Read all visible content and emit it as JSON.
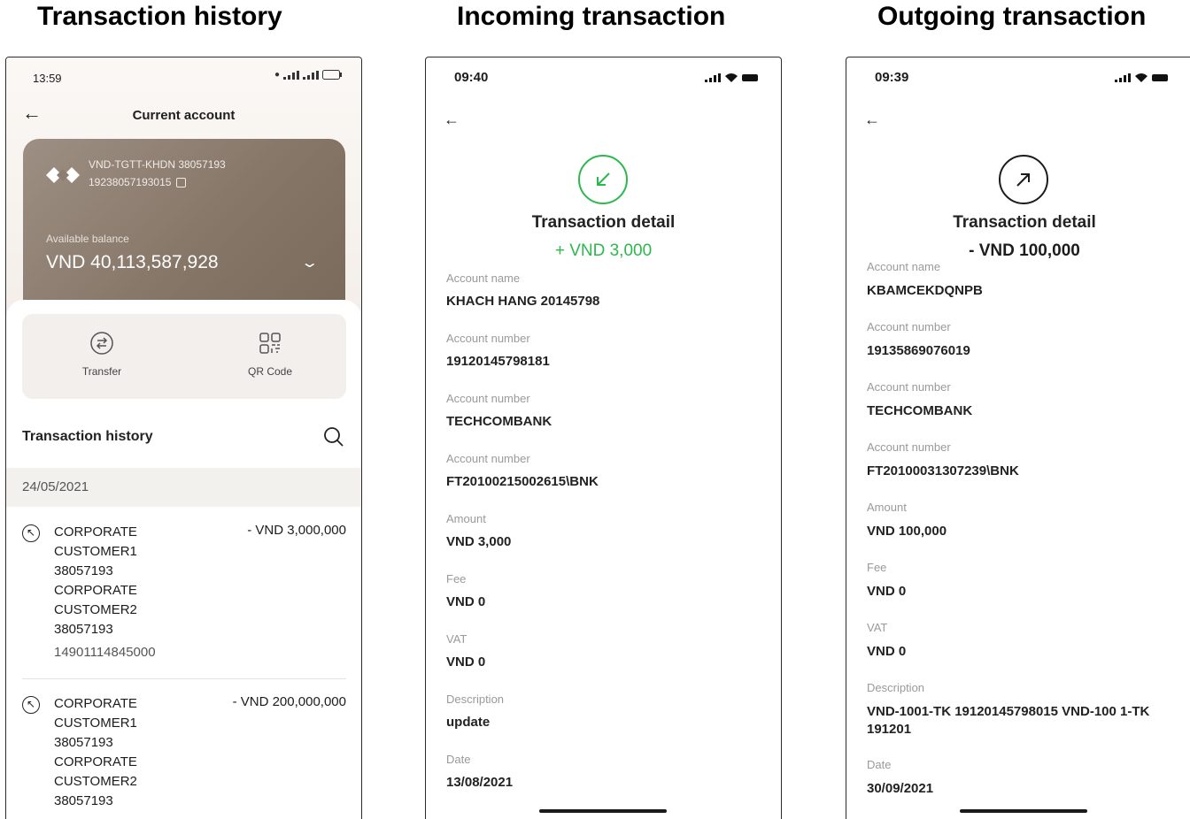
{
  "headings": {
    "history": "Transaction history",
    "incoming": "Incoming transaction",
    "outgoing": "Outgoing transaction"
  },
  "phone1": {
    "time": "13:59",
    "header_title": "Current account",
    "card": {
      "account_name": "VND-TGTT-KHDN 38057193",
      "account_number": "19238057193015",
      "balance_label": "Available balance",
      "balance": "VND 40,113,587,928"
    },
    "actions": [
      {
        "label": "Transfer",
        "icon": "transfer-icon"
      },
      {
        "label": "QR Code",
        "icon": "qr-code-icon"
      }
    ],
    "history_title": "Transaction history",
    "date": "24/05/2021",
    "transactions": [
      {
        "lines": [
          "CORPORATE",
          "CUSTOMER1",
          "38057193",
          "CORPORATE",
          "CUSTOMER2",
          "38057193"
        ],
        "ref": "14901114845000",
        "amount": "- VND 3,000,000"
      },
      {
        "lines": [
          "CORPORATE",
          "CUSTOMER1",
          "38057193",
          "CORPORATE",
          "CUSTOMER2",
          "38057193"
        ],
        "ref": "",
        "amount": "- VND 200,000,000"
      }
    ]
  },
  "phone2": {
    "time": "09:40",
    "title": "Transaction detail",
    "amount": "+ VND 3,000",
    "amount_color": "#2db84d",
    "fields": [
      {
        "label": "Account name",
        "value": "KHACH HANG 20145798"
      },
      {
        "label": "Account number",
        "value": "19120145798181"
      },
      {
        "label": "Account number",
        "value": "TECHCOMBANK"
      },
      {
        "label": "Account number",
        "value": "FT20100215002615\\BNK"
      },
      {
        "label": "Amount",
        "value": "VND 3,000"
      },
      {
        "label": "Fee",
        "value": "VND 0"
      },
      {
        "label": "VAT",
        "value": "VND 0"
      },
      {
        "label": "Description",
        "value": "update"
      },
      {
        "label": "Date",
        "value": "13/08/2021"
      }
    ]
  },
  "phone3": {
    "time": "09:39",
    "title": "Transaction detail",
    "amount": "- VND 100,000",
    "amount_color": "#1c1c1c",
    "fields": [
      {
        "label": "Account name",
        "value": "KBAMCEKDQNPB"
      },
      {
        "label": "Account number",
        "value": "19135869076019"
      },
      {
        "label": "Account number",
        "value": "TECHCOMBANK"
      },
      {
        "label": "Account number",
        "value": "FT20100031307239\\BNK"
      },
      {
        "label": "Amount",
        "value": "VND 100,000"
      },
      {
        "label": "Fee",
        "value": "VND 0"
      },
      {
        "label": "VAT",
        "value": "VND 0"
      },
      {
        "label": "Description",
        "value": "VND-1001-TK 19120145798015 VND-100 1-TK 191201"
      },
      {
        "label": "Date",
        "value": "30/09/2021"
      }
    ]
  }
}
